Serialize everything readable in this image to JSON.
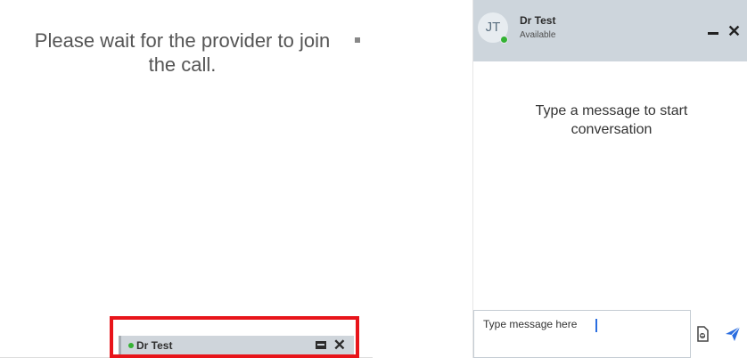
{
  "waiting_screen": {
    "message": "Please wait for the provider to join the call."
  },
  "minimized_chat": {
    "name": "Dr Test",
    "close_glyph": "✕",
    "maximize_icon": "window-maximize-icon",
    "status_color": "#34b233",
    "highlight_color": "#e8141a"
  },
  "chat_window": {
    "header": {
      "avatar_initials": "JT",
      "name": "Dr Test",
      "status": "Available",
      "close_glyph": "✕",
      "minimize_icon": "minimize-icon"
    },
    "body": {
      "empty_state": "Type a message to start conversation"
    },
    "input": {
      "placeholder": "Type message here",
      "attach_icon": "file-attach-icon",
      "send_icon": "send-icon"
    },
    "colors": {
      "header_bg": "#cdd5dc",
      "send_accent": "#2a6de0"
    }
  }
}
